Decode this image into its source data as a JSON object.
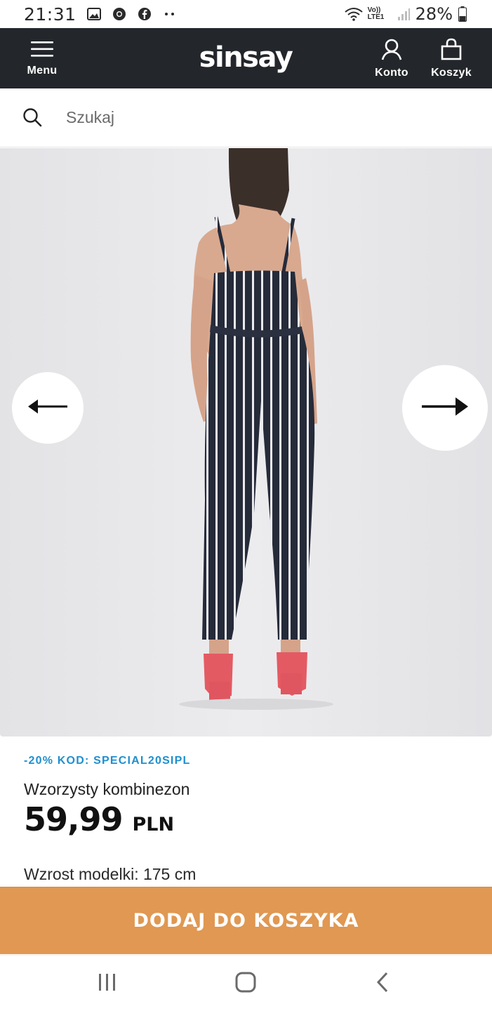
{
  "status_bar": {
    "time": "21:31",
    "battery": "28%",
    "network": "Vo)) LTE1"
  },
  "header": {
    "menu_label": "Menu",
    "logo_text": "sinsay",
    "account_label": "Konto",
    "cart_label": "Koszyk",
    "background_color": "#23272b"
  },
  "search": {
    "placeholder": "Szukaj"
  },
  "gallery": {
    "prev_icon": "arrow-left-icon",
    "next_icon": "arrow-right-icon"
  },
  "product": {
    "promo": "-20% KOD: SPECIAL20SIPL",
    "promo_color": "#1e8fd0",
    "name": "Wzorzysty kombinezon",
    "price": "59,99",
    "currency": "PLN",
    "model_height": "Wzrost modelki: 175 cm"
  },
  "cta": {
    "label": "DODAJ DO KOSZYKA",
    "color": "#e09852"
  },
  "nav_bar": {
    "recent_icon": "recent-apps-icon",
    "home_icon": "home-icon",
    "back_icon": "back-icon"
  }
}
